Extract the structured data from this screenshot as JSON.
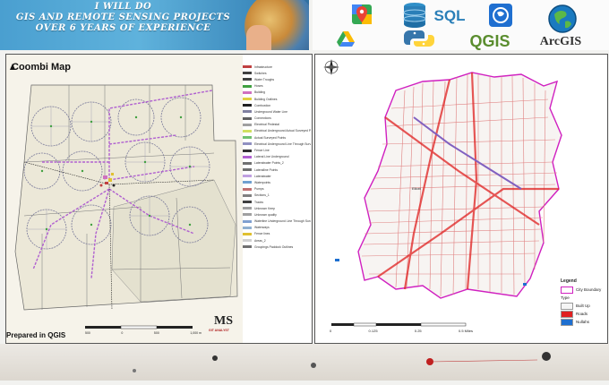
{
  "banner": {
    "title_lines": [
      "I WILL DO",
      "GIS AND REMOTE SENSING PROJECTS",
      "OVER 6 YEARS OF EXPERIENCE"
    ]
  },
  "logos": {
    "sql_label": "SQL",
    "qgis_label": "QGIS",
    "arcgis_label": "ArcGIS"
  },
  "left_map": {
    "title": "Coombi Map",
    "footer": "Prepared in QGIS",
    "scale_labels": [
      "500",
      "0",
      "500",
      "1,000 m"
    ],
    "signature": "MS",
    "signature_sub": "GIT ANALYST",
    "legend": [
      {
        "label": "Infrastructure",
        "color": "#c04040"
      },
      {
        "label": "Switches",
        "color": "#404040"
      },
      {
        "label": "Water Troughs",
        "color": "#404040"
      },
      {
        "label": "Hoses",
        "color": "#40a040"
      },
      {
        "label": "Building",
        "color": "#d070c0"
      },
      {
        "label": "Building Outlines",
        "color": "#e0d040"
      },
      {
        "label": "Combustion",
        "color": "#202020"
      },
      {
        "label": "Underground Water Line",
        "color": "#8080a0"
      },
      {
        "label": "Connections",
        "color": "#606060"
      },
      {
        "label": "Electrical Pedestal",
        "color": "#a0a0a0"
      },
      {
        "label": "Electrical Underground Actual Surveyed Points",
        "color": "#d0e060"
      },
      {
        "label": "Actual Surveyed Points",
        "color": "#70c070"
      },
      {
        "label": "Electrical Underground Line Through Surveyed Points",
        "color": "#9090c0"
      },
      {
        "label": "Fence Line",
        "color": "#303030"
      },
      {
        "label": "Lateral Line Underground",
        "color": "#b060d0"
      },
      {
        "label": "Lateralwater Points_2",
        "color": "#707070"
      },
      {
        "label": "Lateralline Points",
        "color": "#707070"
      },
      {
        "label": "Lateralwater",
        "color": "#c0a0e0"
      },
      {
        "label": "Waterpoints",
        "color": "#70a0d0"
      },
      {
        "label": "Pumps",
        "color": "#c07070"
      },
      {
        "label": "Sections_1",
        "color": "#808080"
      },
      {
        "label": "Tracks",
        "color": "#404040"
      },
      {
        "label": "Unknown Keep",
        "color": "#a0a0a0"
      },
      {
        "label": "Unknown quality",
        "color": "#a0a0a0"
      },
      {
        "label": "Waterline Underground Line Through Surveyed Points",
        "color": "#80a0d0"
      },
      {
        "label": "Waterways",
        "color": "#90b0d0"
      },
      {
        "label": "Fence lines",
        "color": "#e0c030"
      },
      {
        "label": "Areas_2",
        "color": "#d0d0d0"
      },
      {
        "label": "Groupings Paddock Outlines",
        "color": "#707070"
      }
    ]
  },
  "right_map": {
    "place_label": "Elliott",
    "legend_title": "Legend",
    "legend_items": [
      {
        "label": "City Boundary",
        "color": "#ffffff",
        "border": "#d020c0"
      },
      {
        "label": "Type",
        "color": "none",
        "border": "none"
      },
      {
        "label": "Built Up",
        "color": "#f5f5f5",
        "border": "#999999"
      },
      {
        "label": "Roads",
        "color": "#e02020",
        "border": "#999999"
      },
      {
        "label": "Nullahs",
        "color": "#1e6fd0",
        "border": "#999999"
      }
    ],
    "scale_labels": [
      "0",
      "0.125",
      "0.25",
      "0.5 Miles"
    ]
  },
  "colors": {
    "boundary": "#d020c0",
    "roads": "#e02020",
    "nullah": "#1e6fd0"
  }
}
